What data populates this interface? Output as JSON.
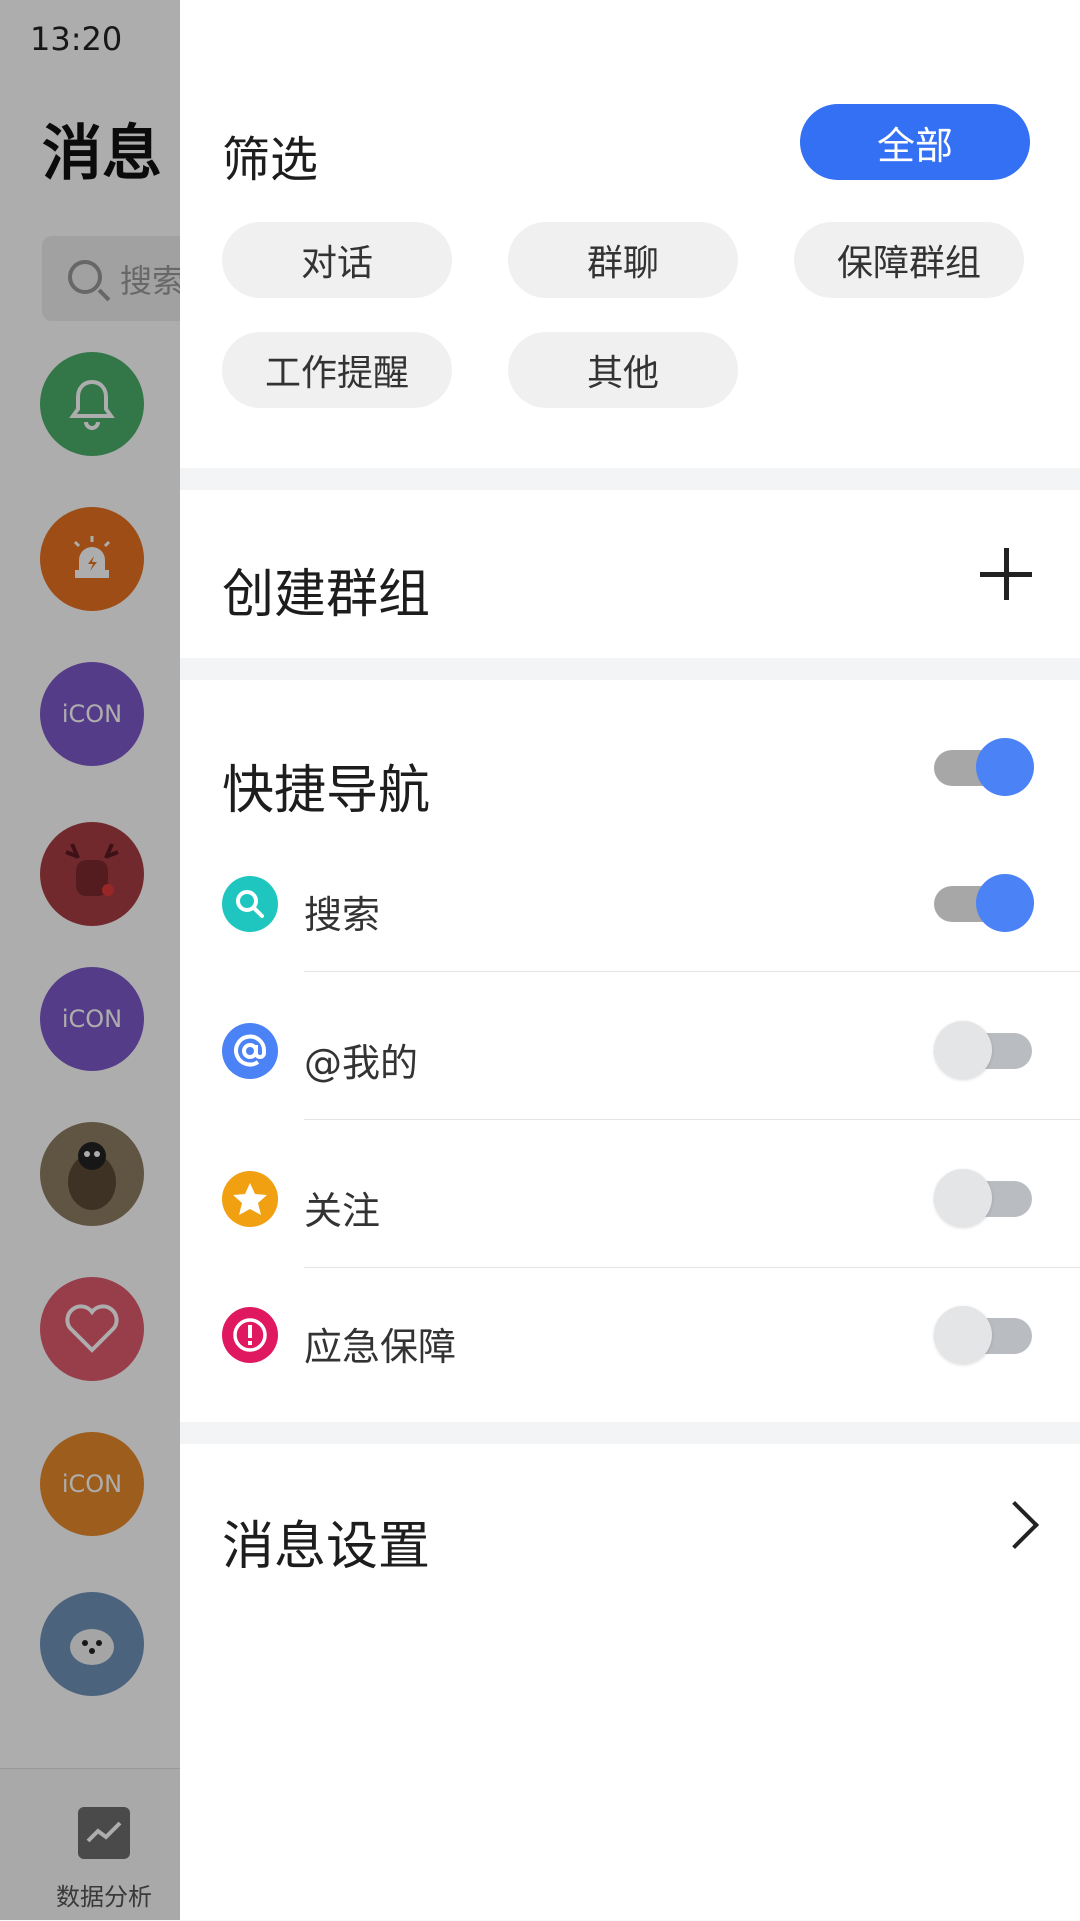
{
  "background": {
    "status_time": "13:20",
    "title": "消息",
    "search_placeholder": "搜索",
    "avatars": [
      {
        "name": "bell",
        "color": "#4caf6a",
        "text": ""
      },
      {
        "name": "alarm",
        "color": "#e8721f",
        "text": ""
      },
      {
        "name": "icon-purple",
        "color": "#7d59c9",
        "text": "iCON"
      },
      {
        "name": "reindeer",
        "color": "#a83d43",
        "text": ""
      },
      {
        "name": "icon-purple-2",
        "color": "#7d59c9",
        "text": "iCON"
      },
      {
        "name": "penguin",
        "color": "#8e7c62",
        "text": ""
      },
      {
        "name": "heart",
        "color": "#e05b6e",
        "text": ""
      },
      {
        "name": "icon-orange",
        "color": "#e8892a",
        "text": "iCON"
      },
      {
        "name": "polar-bear",
        "color": "#6f93b8",
        "text": ""
      }
    ],
    "tab_label": "数据分析"
  },
  "drawer": {
    "filter": {
      "title": "筛选",
      "all_label": "全部",
      "chips": [
        "对话",
        "群聊",
        "保障群组",
        "工作提醒",
        "其他"
      ]
    },
    "create_group": {
      "label": "创建群组"
    },
    "quick_nav": {
      "title": "快捷导航",
      "enabled": true,
      "items": [
        {
          "label": "搜索",
          "icon": "search-icon",
          "color": "#1fc6c0",
          "on": true
        },
        {
          "label": "@我的",
          "icon": "at-icon",
          "color": "#4b82f5",
          "on": false
        },
        {
          "label": "关注",
          "icon": "star-icon",
          "color": "#f0a010",
          "on": false
        },
        {
          "label": "应急保障",
          "icon": "alert-icon",
          "color": "#e0185f",
          "on": false
        }
      ]
    },
    "message_settings": {
      "label": "消息设置"
    }
  },
  "colors": {
    "accent": "#3470f4",
    "toggle_on": "#4b82f5"
  }
}
